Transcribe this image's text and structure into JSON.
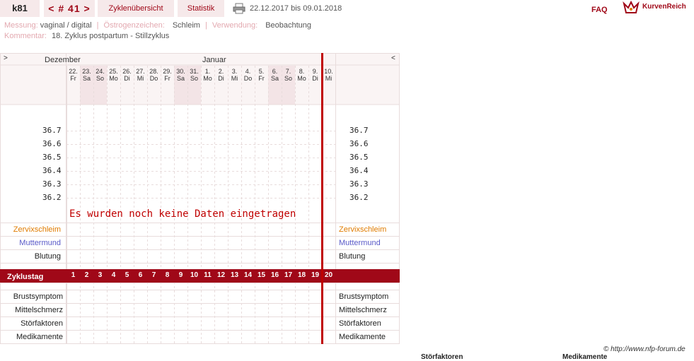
{
  "nav": {
    "user": "k81",
    "cycle": "< # 41 >",
    "overview": "Zyklenübersicht",
    "stats": "Statistik",
    "daterange": "22.12.2017 bis 09.01.2018",
    "faq": "FAQ",
    "brand": "KurvenReich"
  },
  "meta": {
    "messung_label": "Messung:",
    "messung": "vaginal / digital",
    "oestrogen_label": "Östrogenzeichen:",
    "oestrogen": "Schleim",
    "verwendung_label": "Verwendung:",
    "verwendung": "Beobachtung",
    "kommentar_label": "Kommentar:",
    "kommentar": "18. Zyklus postpartum - Stillzyklus"
  },
  "chart": {
    "nav_left": ">",
    "nav_right": "<",
    "month1": "Dezember",
    "month2": "Januar",
    "days": [
      {
        "d": "22.",
        "w": "Fr",
        "we": false
      },
      {
        "d": "23.",
        "w": "Sa",
        "we": true
      },
      {
        "d": "24.",
        "w": "So",
        "we": true
      },
      {
        "d": "25.",
        "w": "Mo",
        "we": false
      },
      {
        "d": "26.",
        "w": "Di",
        "we": false
      },
      {
        "d": "27.",
        "w": "Mi",
        "we": false
      },
      {
        "d": "28.",
        "w": "Do",
        "we": false
      },
      {
        "d": "29.",
        "w": "Fr",
        "we": false
      },
      {
        "d": "30.",
        "w": "Sa",
        "we": true
      },
      {
        "d": "31.",
        "w": "So",
        "we": true
      },
      {
        "d": "1.",
        "w": "Mo",
        "we": false
      },
      {
        "d": "2.",
        "w": "Di",
        "we": false
      },
      {
        "d": "3.",
        "w": "Mi",
        "we": false
      },
      {
        "d": "4.",
        "w": "Do",
        "we": false
      },
      {
        "d": "5.",
        "w": "Fr",
        "we": false
      },
      {
        "d": "6.",
        "w": "Sa",
        "we": true
      },
      {
        "d": "7.",
        "w": "So",
        "we": true
      },
      {
        "d": "8.",
        "w": "Mo",
        "we": false
      },
      {
        "d": "9.",
        "w": "Di",
        "we": false
      },
      {
        "d": "10.",
        "w": "Mi",
        "we": false
      }
    ],
    "temps": [
      "36.7",
      "36.6",
      "36.5",
      "36.4",
      "36.3",
      "36.2"
    ],
    "nodata": "Es wurden noch keine Daten eingetragen",
    "rows_top": [
      {
        "label": "Zervixschleim",
        "color": "#e07b00"
      },
      {
        "label": "Muttermund",
        "color": "#5a5ac8"
      },
      {
        "label": "Blutung",
        "color": "#222222"
      }
    ],
    "zyklustag_label": "Zyklustag",
    "cycle_days": [
      "1",
      "2",
      "3",
      "4",
      "5",
      "6",
      "7",
      "8",
      "9",
      "10",
      "11",
      "12",
      "13",
      "14",
      "15",
      "16",
      "17",
      "18",
      "19",
      "20"
    ],
    "rows_bottom": [
      "Brustsymptom",
      "Mittelschmerz",
      "Störfaktoren",
      "Medikamente"
    ]
  },
  "colors": {
    "accent": "#a00818",
    "band": "#a00818",
    "weekend": "#f3e4e6",
    "grid": "#e8dcdc",
    "today": "#c00000"
  },
  "footer": "© http://www.nfp-forum.de",
  "bottom": {
    "stoer": "Störfaktoren",
    "medi": "Medikamente"
  }
}
